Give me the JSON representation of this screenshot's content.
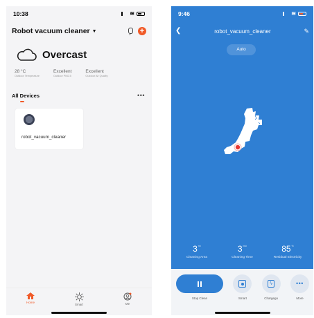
{
  "left_phone": {
    "status_time": "10:38",
    "header_title": "Robot vacuum cleaner",
    "weather": {
      "condition": "Overcast",
      "stats": [
        {
          "value": "28 °C",
          "label": "Outdoor Temperature"
        },
        {
          "value": "Excellent",
          "label": "Outdoor PM2.5"
        },
        {
          "value": "Excellent",
          "label": "Outdoor Air Quality"
        }
      ]
    },
    "devices_label": "All Devices",
    "more_label": "•••",
    "device": {
      "name": "robot_vacuum_cleaner"
    },
    "tabs": [
      {
        "label": "Home",
        "icon": "home-icon",
        "active": true
      },
      {
        "label": "Smart",
        "icon": "sun-icon",
        "active": false
      },
      {
        "label": "Me",
        "icon": "me-icon",
        "active": false
      }
    ],
    "colors": {
      "accent": "#f05a28"
    }
  },
  "right_phone": {
    "status_time": "9:46",
    "title": "robot_vacuum_cleaner",
    "mode": "Auto",
    "stats": [
      {
        "value": "3",
        "unit": "m²",
        "label": "Cleaning Area"
      },
      {
        "value": "3",
        "unit": "min",
        "label": "Cleaning Time"
      },
      {
        "value": "85",
        "unit": "%",
        "label": "Residual Electricity"
      }
    ],
    "controls": [
      {
        "label": "Stop Clean",
        "icon": "pause-icon"
      },
      {
        "label": "Smart",
        "icon": "smart-icon"
      },
      {
        "label": "Chargego",
        "icon": "charge-icon"
      },
      {
        "label": "More",
        "icon": "more-icon"
      }
    ],
    "colors": {
      "primary": "#2f7fd3",
      "robot_dot": "#e53935"
    }
  }
}
